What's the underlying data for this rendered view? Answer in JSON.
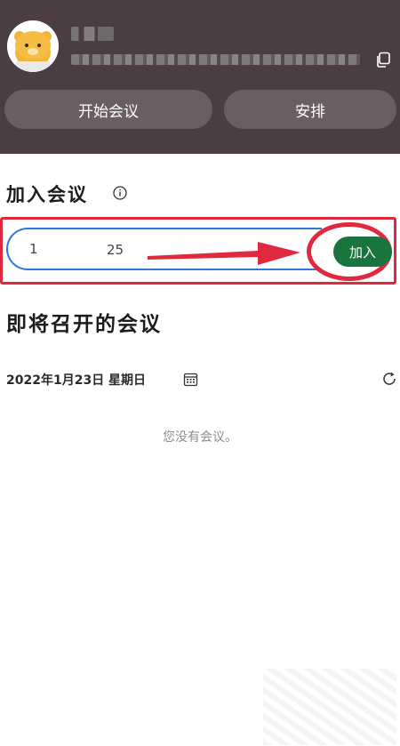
{
  "header": {
    "avatar_icon": "cartoon-bear-avatar",
    "start_meeting_label": "开始会议",
    "schedule_label": "安排",
    "copy_icon": "copy-icon",
    "colors": {
      "background": "#4a3e43",
      "button": "#6a5e63"
    }
  },
  "join": {
    "title": "加入会议",
    "info_icon": "info-icon",
    "input_value": "1",
    "input_value_end": "25",
    "button_label": "加入",
    "colors": {
      "button": "#19743e",
      "annotation": "#e0283f",
      "input_border": "#2f79d6"
    }
  },
  "upcoming": {
    "title": "即将召开的会议",
    "date": "2022年1月23日 星期日",
    "calendar_icon": "calendar-icon",
    "refresh_icon": "refresh-icon",
    "empty_message": "您没有会议。"
  }
}
